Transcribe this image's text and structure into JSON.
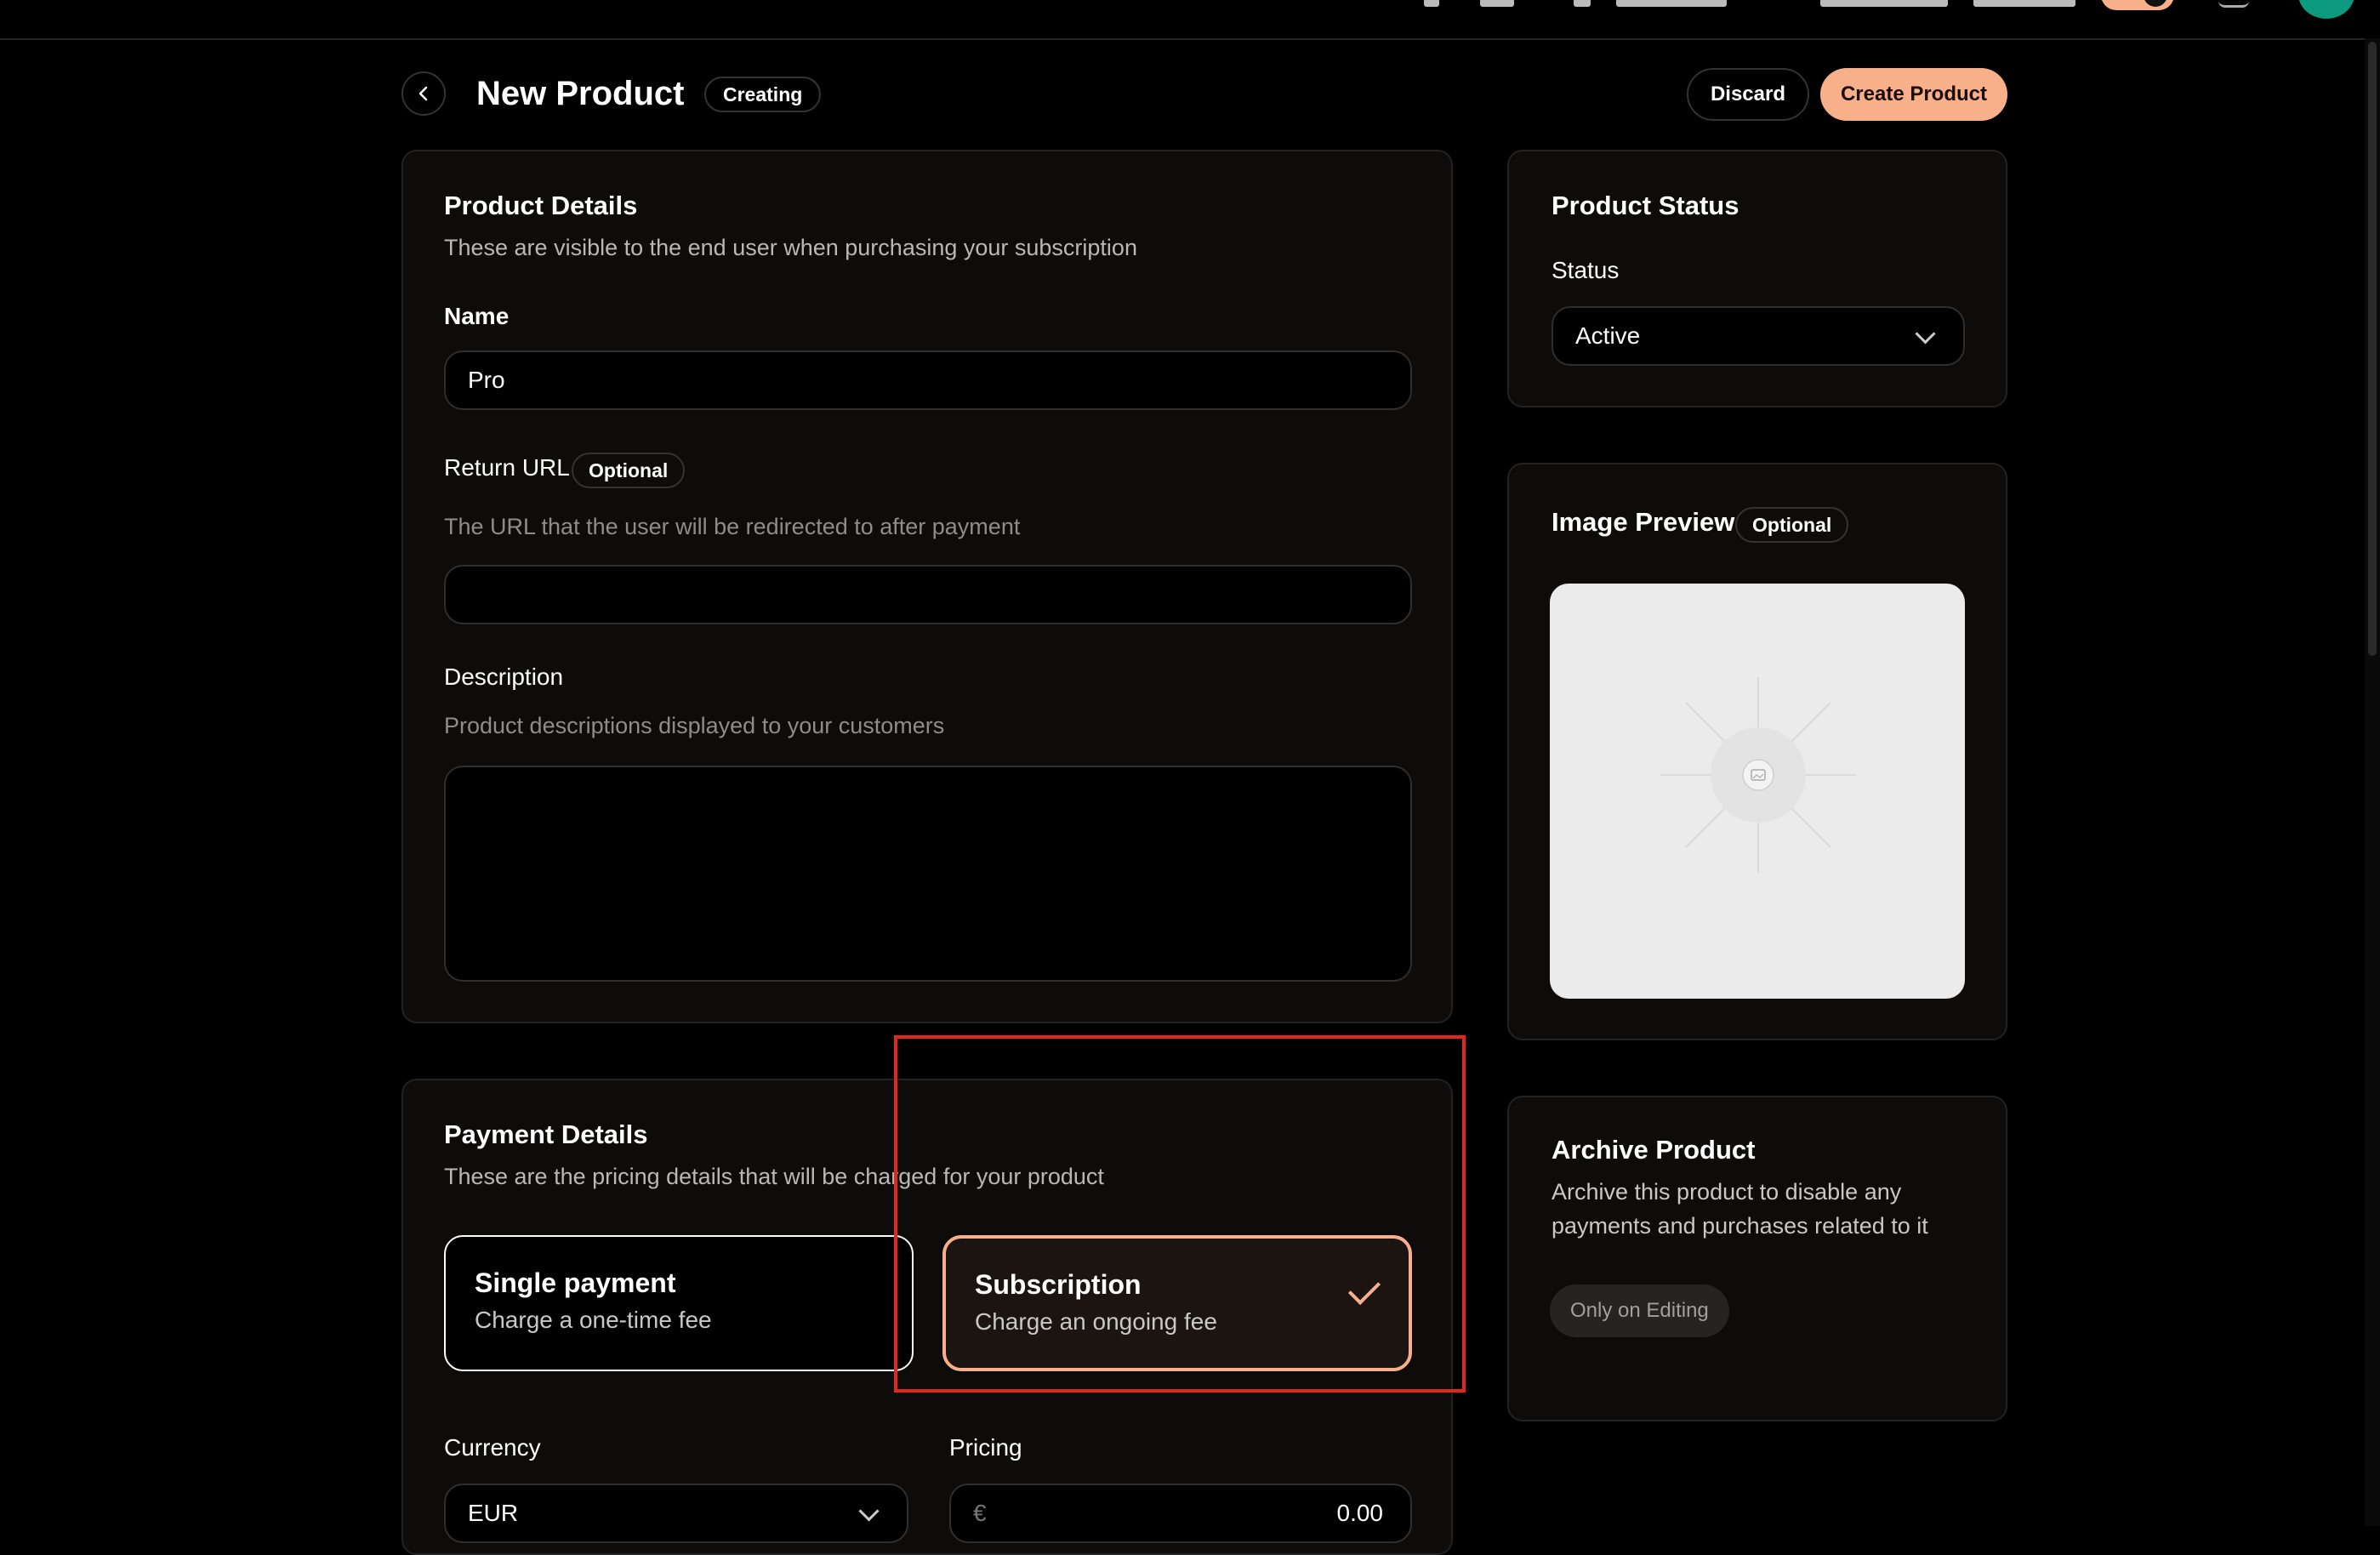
{
  "topbar": {
    "items": [
      "...",
      "...",
      "...",
      "..."
    ]
  },
  "header": {
    "title": "New Product",
    "badge": "Creating",
    "discard_label": "Discard",
    "create_label": "Create Product"
  },
  "product_details": {
    "title": "Product Details",
    "subtitle": "These are visible to the end user when purchasing your subscription",
    "name_label": "Name",
    "name_value": "Pro",
    "return_url_label": "Return URL",
    "return_url_badge": "Optional",
    "return_url_hint": "The URL that the user will be redirected to after payment",
    "return_url_value": "",
    "description_label": "Description",
    "description_hint": "Product descriptions displayed to your customers",
    "description_value": ""
  },
  "payment_details": {
    "title": "Payment Details",
    "subtitle": "These are the pricing details that will be charged for your product",
    "options": [
      {
        "title": "Single payment",
        "subtitle": "Charge a one-time fee",
        "selected": false
      },
      {
        "title": "Subscription",
        "subtitle": "Charge an ongoing fee",
        "selected": true
      }
    ],
    "currency_label": "Currency",
    "currency_value": "EUR",
    "pricing_label": "Pricing",
    "pricing_symbol": "€",
    "pricing_value": "0.00"
  },
  "product_status": {
    "title": "Product Status",
    "status_label": "Status",
    "status_value": "Active"
  },
  "image_preview": {
    "title": "Image Preview",
    "badge": "Optional"
  },
  "archive": {
    "title": "Archive Product",
    "subtitle_line1": "Archive this product to disable any",
    "subtitle_line2": "payments and purchases related to it",
    "button_label": "Only on Editing"
  },
  "colors": {
    "accent": "#f8b08a",
    "background": "#000000",
    "card": "#0e0c0b",
    "highlight": "#e1261c"
  },
  "icons": [
    "back-chevron-icon",
    "chevron-down-icon",
    "check-icon",
    "image-placeholder-icon",
    "bell-icon"
  ]
}
